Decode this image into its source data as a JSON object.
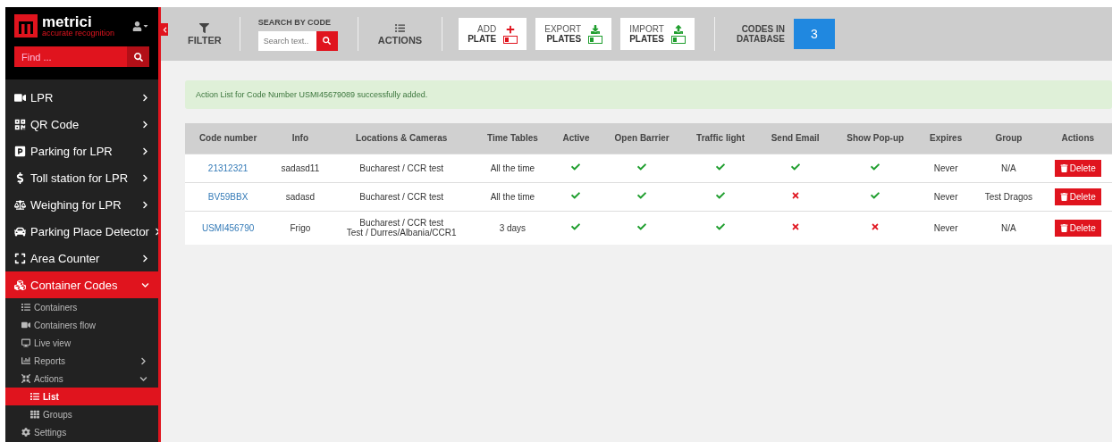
{
  "brand": {
    "name": "metrici",
    "tagline": "accurate recognition"
  },
  "sidebar": {
    "search": {
      "placeholder": "Find ..."
    },
    "items": [
      {
        "label": "LPR",
        "expanded": false,
        "selected": false
      },
      {
        "label": "QR Code",
        "expanded": false,
        "selected": false
      },
      {
        "label": "Parking for LPR",
        "expanded": false,
        "selected": false
      },
      {
        "label": "Toll station for LPR",
        "expanded": false,
        "selected": false
      },
      {
        "label": "Weighing for LPR",
        "expanded": false,
        "selected": false
      },
      {
        "label": "Parking Place Detector",
        "expanded": false,
        "selected": false
      },
      {
        "label": "Area Counter",
        "expanded": false,
        "selected": false
      },
      {
        "label": "Container Codes",
        "expanded": true,
        "selected": true,
        "children": [
          {
            "label": "Containers",
            "selected": false
          },
          {
            "label": "Containers flow",
            "selected": false
          },
          {
            "label": "Live view",
            "selected": false
          },
          {
            "label": "Reports",
            "expanded": false,
            "selected": false
          },
          {
            "label": "Actions",
            "expanded": true,
            "selected": false,
            "children": [
              {
                "label": "List",
                "selected": true
              },
              {
                "label": "Groups",
                "selected": false
              }
            ]
          },
          {
            "label": "Settings",
            "selected": false
          }
        ]
      }
    ]
  },
  "toolbar": {
    "filter": "FILTER",
    "search": {
      "label": "SEARCH BY CODE",
      "placeholder": "Search text.."
    },
    "actions": "ACTIONS",
    "buttons": [
      {
        "kind": "add",
        "line1": "ADD",
        "line2": "PLATE"
      },
      {
        "kind": "export",
        "line1": "EXPORT",
        "line2": "PLATES"
      },
      {
        "kind": "import",
        "line1": "IMPORT",
        "line2": "PLATES"
      }
    ],
    "codes_label": [
      "CODES IN",
      "DATABASE"
    ],
    "codes_count": "3"
  },
  "alert": "Action List for Code Number USMI45679089 successfully added.",
  "table": {
    "columns": [
      "Code number",
      "Info",
      "Locations & Cameras",
      "Time Tables",
      "Active",
      "Open Barrier",
      "Traffic light",
      "Send Email",
      "Show Pop-up",
      "Expires",
      "Group",
      "Actions"
    ],
    "rows": [
      {
        "code": "21312321",
        "info": "sadasd11",
        "locations": [
          "Bucharest / CCR test"
        ],
        "time_tables": "All the time",
        "active": true,
        "open_barrier": true,
        "traffic_light": true,
        "send_email": true,
        "show_popup": true,
        "expires": "Never",
        "group": "N/A",
        "action": "Delete"
      },
      {
        "code": "BV59BBX",
        "info": "sadasd",
        "locations": [
          "Bucharest / CCR test"
        ],
        "time_tables": "All the time",
        "active": true,
        "open_barrier": true,
        "traffic_light": true,
        "send_email": false,
        "show_popup": true,
        "expires": "Never",
        "group": "Test Dragos",
        "action": "Delete"
      },
      {
        "code": "USMI456790",
        "info": "Frigo",
        "locations": [
          "Bucharest / CCR test",
          "Test / Durres/Albania/CCR1"
        ],
        "time_tables": "3 days",
        "active": true,
        "open_barrier": true,
        "traffic_light": true,
        "send_email": false,
        "show_popup": false,
        "expires": "Never",
        "group": "N/A",
        "action": "Delete"
      }
    ]
  }
}
